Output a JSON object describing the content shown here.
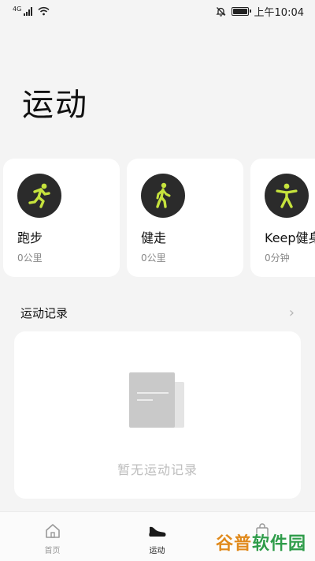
{
  "status_bar": {
    "network_type": "4G",
    "time": "上午10:04"
  },
  "page": {
    "title": "运动"
  },
  "sport_cards": [
    {
      "name": "跑步",
      "value": "0公里",
      "icon": "running-icon"
    },
    {
      "name": "健走",
      "value": "0公里",
      "icon": "walking-icon"
    },
    {
      "name": "Keep健身",
      "value": "0分钟",
      "icon": "keep-fitness-icon"
    }
  ],
  "records": {
    "title": "运动记录",
    "empty_text": "暂无运动记录"
  },
  "tabs": [
    {
      "label": "首页",
      "icon": "home-icon",
      "active": false
    },
    {
      "label": "运动",
      "icon": "sneaker-icon",
      "active": true
    },
    {
      "label": "",
      "icon": "shopping-bag-icon",
      "active": false
    }
  ],
  "watermark": {
    "part1": "谷普",
    "part2": "软件园"
  },
  "colors": {
    "accent_icon": "#c6e33d",
    "icon_background": "#2b2b2b",
    "background": "#f4f4f4",
    "card": "#ffffff"
  }
}
